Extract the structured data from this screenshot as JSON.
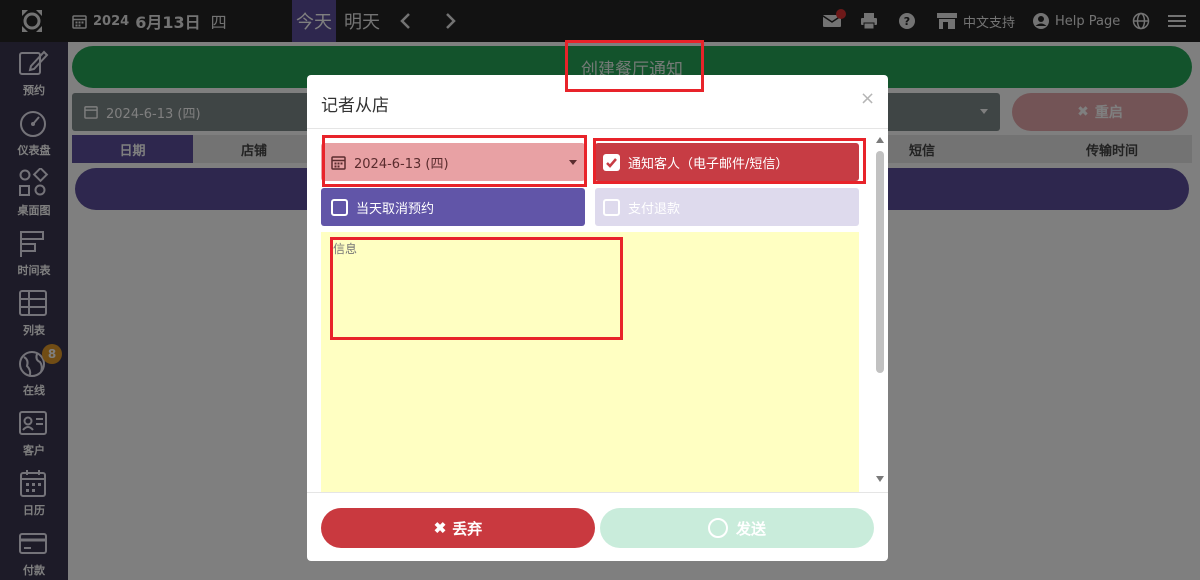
{
  "topbar": {
    "year": "2024",
    "date": "6月13日",
    "weekday": "四",
    "today_label": "今天",
    "tomorrow_label": "明天",
    "support_label": "中文支持",
    "help_label": "Help Page",
    "mail_badge": "1"
  },
  "sidebar": {
    "items": [
      {
        "label": "预约",
        "icon": "edit-icon"
      },
      {
        "label": "仪表盘",
        "icon": "dashboard-icon"
      },
      {
        "label": "桌面图",
        "icon": "floorplan-icon"
      },
      {
        "label": "时间表",
        "icon": "timeline-icon"
      },
      {
        "label": "列表",
        "icon": "list-icon"
      },
      {
        "label": "在线",
        "icon": "globe-icon",
        "badge": "8"
      },
      {
        "label": "客户",
        "icon": "customer-icon"
      },
      {
        "label": "日历",
        "icon": "calendar-icon"
      },
      {
        "label": "付款",
        "icon": "payment-icon"
      }
    ]
  },
  "main": {
    "create_notice_label": "创建餐厅通知",
    "filter_date": "2024-6-13 (四)",
    "reset_label": "重启",
    "columns": [
      "日期",
      "店铺",
      "短信",
      "传输时间"
    ]
  },
  "modal": {
    "title": "记者从店",
    "close_symbol": "×",
    "date_value": "2024-6-13 (四)",
    "notify_label": "通知客人（电子邮件/短信）",
    "notify_checked": true,
    "cancel_label": "当天取消预约",
    "cancel_checked": false,
    "refund_label": "支付退款",
    "refund_checked": false,
    "message_placeholder": "信息",
    "discard_label": "丢弃",
    "send_label": "发送"
  },
  "colors": {
    "accent_purple": "#5c4f9c",
    "danger_red": "#c9393f",
    "success_green": "#27a659",
    "annotation_red": "#e8232a"
  }
}
